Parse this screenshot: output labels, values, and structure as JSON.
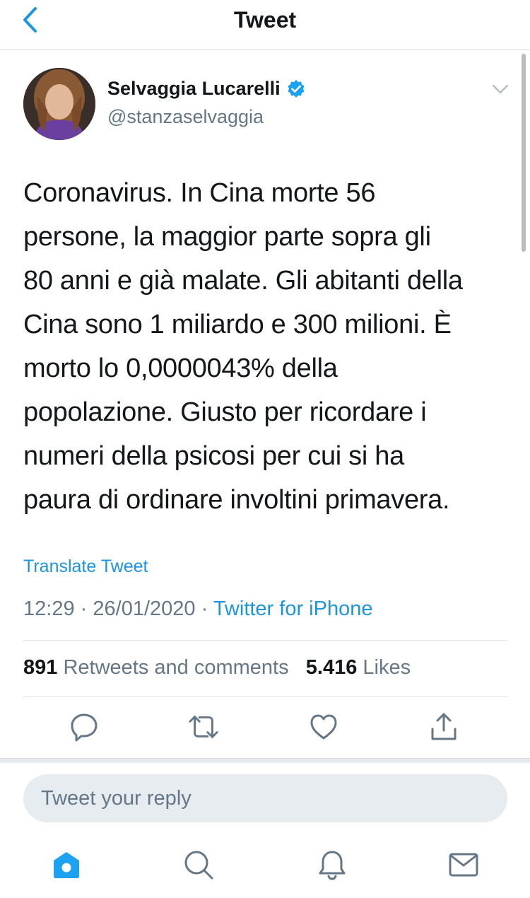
{
  "header": {
    "title": "Tweet",
    "back_icon": "chevron-left-icon"
  },
  "tweet": {
    "author": {
      "name": "Selvaggia Lucarelli",
      "handle": "@stanzaselvaggia",
      "verified": true
    },
    "text": "Coronavirus. In Cina morte 56\npersone, la maggior parte sopra gli\n80 anni e già malate. Gli abitanti della\nCina sono 1 miliardo e 300 milioni. È\nmorto lo 0,0000043% della\npopolazione. Giusto per ricordare i\nnumeri della psicosi per cui si ha\npaura di ordinare involtini primavera.",
    "translate_label": "Translate Tweet",
    "time": "12:29",
    "separator": "·",
    "date": "26/01/2020",
    "client": "Twitter for iPhone",
    "retweets_count": "891",
    "retweets_label": "Retweets and comments",
    "likes_count": "5.416",
    "likes_label": "Likes"
  },
  "actions": [
    "reply-icon",
    "retweet-icon",
    "like-icon",
    "share-icon"
  ],
  "reply": {
    "placeholder": "Tweet your reply"
  },
  "tabbar": [
    "home-icon",
    "search-icon",
    "notifications-icon",
    "messages-icon"
  ],
  "colors": {
    "accent": "#1b95e0",
    "text": "#14171a",
    "secondary": "#657786",
    "reply_bg": "#e6ecf0"
  }
}
